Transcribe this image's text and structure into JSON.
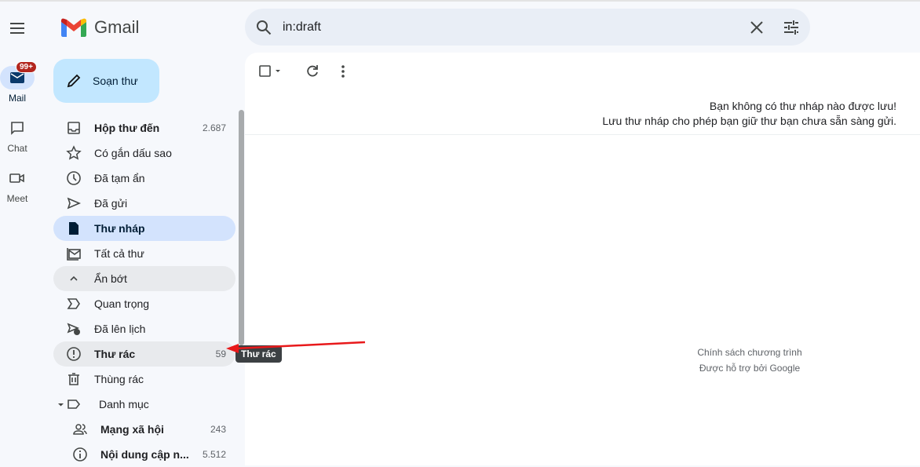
{
  "app": {
    "name": "Gmail"
  },
  "rail": [
    {
      "label": "Mail",
      "badge": "99+"
    },
    {
      "label": "Chat"
    },
    {
      "label": "Meet"
    }
  ],
  "compose_label": "Soạn thư",
  "nav": [
    {
      "label": "Hộp thư đến",
      "count": "2.687",
      "icon": "inbox-icon",
      "bold": true
    },
    {
      "label": "Có gắn dấu sao",
      "count": "",
      "icon": "star-icon"
    },
    {
      "label": "Đã tạm ẩn",
      "count": "",
      "icon": "clock-icon"
    },
    {
      "label": "Đã gửi",
      "count": "",
      "icon": "send-icon"
    },
    {
      "label": "Thư nháp",
      "count": "",
      "icon": "draft-icon",
      "bold": true,
      "active": true
    },
    {
      "label": "Tất cả thư",
      "count": "",
      "icon": "all-mail-icon"
    },
    {
      "label": "Ẩn bớt",
      "count": "",
      "icon": "chevron-up-icon"
    },
    {
      "label": "Quan trọng",
      "count": "",
      "icon": "important-icon"
    },
    {
      "label": "Đã lên lịch",
      "count": "",
      "icon": "scheduled-icon"
    },
    {
      "label": "Thư rác",
      "count": "59",
      "icon": "spam-icon",
      "bold": true
    },
    {
      "label": "Thùng rác",
      "count": "",
      "icon": "trash-icon"
    },
    {
      "label": "Danh mục",
      "count": "",
      "icon": "label-icon"
    },
    {
      "label": "Mạng xã hội",
      "count": "243",
      "icon": "social-icon",
      "bold": true
    },
    {
      "label": "Nội dung cập n...",
      "count": "5.512",
      "icon": "updates-icon",
      "bold": true
    }
  ],
  "search": {
    "value": "in:draft"
  },
  "empty": {
    "line1": "Bạn không có thư nháp nào được lưu!",
    "line2": "Lưu thư nháp cho phép bạn giữ thư bạn chưa sẵn sàng gửi."
  },
  "footer": {
    "line1": "Chính sách chương trình",
    "line2": "Được hỗ trợ bởi Google"
  },
  "tooltip": "Thư rác",
  "colors": {
    "accent": "#c2e7ff",
    "active": "#d3e3fd",
    "badge": "#b3261e",
    "arrow": "#e8191b"
  }
}
